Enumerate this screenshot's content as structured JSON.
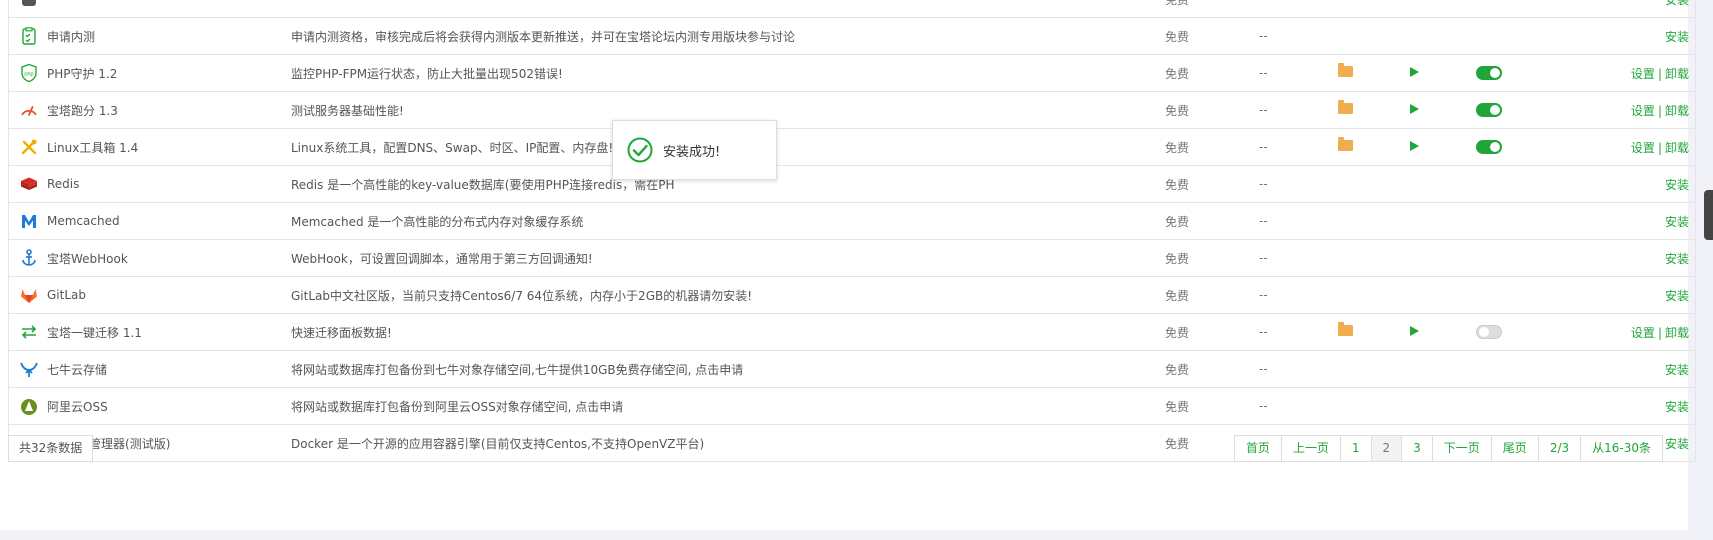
{
  "plugins": [
    {
      "name": "",
      "desc": "",
      "price": "免费",
      "expire": "--",
      "installed": false,
      "icon": "plugin-icon",
      "action": "安装"
    },
    {
      "name": "申请内测",
      "desc": "申请内测资格，审核完成后将会获得内测版本更新推送，并可在宝塔论坛内测专用版块参与讨论",
      "price": "免费",
      "expire": "--",
      "installed": false,
      "icon": "beta-apply-icon",
      "action": "安装"
    },
    {
      "name": "PHP守护 1.2",
      "desc": "监控PHP-FPM运行状态，防止大批量出现502错误!",
      "price": "免费",
      "expire": "--",
      "installed": true,
      "toggle": true,
      "icon": "php-guard-icon",
      "settings": "设置",
      "uninstall": "卸载"
    },
    {
      "name": "宝塔跑分 1.3",
      "desc": "测试服务器基础性能!",
      "price": "免费",
      "expire": "--",
      "installed": true,
      "toggle": true,
      "icon": "speedometer-icon",
      "settings": "设置",
      "uninstall": "卸载"
    },
    {
      "name": "Linux工具箱 1.4",
      "desc": "Linux系统工具，配置DNS、Swap、时区、IP配置、内存盘!",
      "price": "免费",
      "expire": "--",
      "installed": true,
      "toggle": true,
      "icon": "toolbox-icon",
      "settings": "设置",
      "uninstall": "卸载"
    },
    {
      "name": "Redis",
      "desc": "Redis 是一个高性能的key-value数据库(要使用PHP连接redis，需在PH",
      "price": "免费",
      "expire": "--",
      "installed": false,
      "icon": "redis-icon",
      "action": "安装"
    },
    {
      "name": "Memcached",
      "desc": "Memcached 是一个高性能的分布式内存对象缓存系统",
      "price": "免费",
      "expire": "--",
      "installed": false,
      "icon": "memcached-icon",
      "action": "安装"
    },
    {
      "name": "宝塔WebHook",
      "desc": "WebHook，可设置回调脚本，通常用于第三方回调通知!",
      "price": "免费",
      "expire": "--",
      "installed": false,
      "icon": "webhook-anchor-icon",
      "action": "安装"
    },
    {
      "name": "GitLab",
      "desc": "GitLab中文社区版，当前只支持Centos6/7 64位系统，内存小于2GB的机器请勿安装!",
      "price": "免费",
      "expire": "--",
      "installed": false,
      "icon": "gitlab-icon",
      "action": "安装"
    },
    {
      "name": "宝塔一键迁移 1.1",
      "desc": "快速迁移面板数据!",
      "price": "免费",
      "expire": "--",
      "installed": true,
      "toggle": false,
      "icon": "migrate-arrows-icon",
      "settings": "设置",
      "uninstall": "卸载"
    },
    {
      "name": "七牛云存储",
      "desc": "将网站或数据库打包备份到七牛对象存储空间,七牛提供10GB免费存储空间, 点击申请",
      "price": "免费",
      "expire": "--",
      "installed": false,
      "icon": "qiniu-icon",
      "action": "安装"
    },
    {
      "name": "阿里云OSS",
      "desc": "将网站或数据库打包备份到阿里云OSS对象存储空间, 点击申请",
      "price": "免费",
      "expire": "--",
      "installed": false,
      "icon": "aliyun-oss-icon",
      "action": "安装"
    },
    {
      "name": "Docker管理器(测试版)",
      "desc": "Docker 是一个开源的应用容器引擎(目前仅支持Centos,不支持OpenVZ平台)",
      "price": "免费",
      "expire": "--",
      "installed": false,
      "icon": "docker-icon",
      "action": "安装"
    }
  ],
  "footer": {
    "total": "共32条数据"
  },
  "pager": [
    "首页",
    "上一页",
    "1",
    "2",
    "3",
    "下一页",
    "尾页",
    "2/3",
    "从16-30条"
  ],
  "pager_current": "2",
  "toast": {
    "message": "安装成功!"
  },
  "colors": {
    "accent": "#20a53a",
    "folder": "#f0ad4e"
  }
}
